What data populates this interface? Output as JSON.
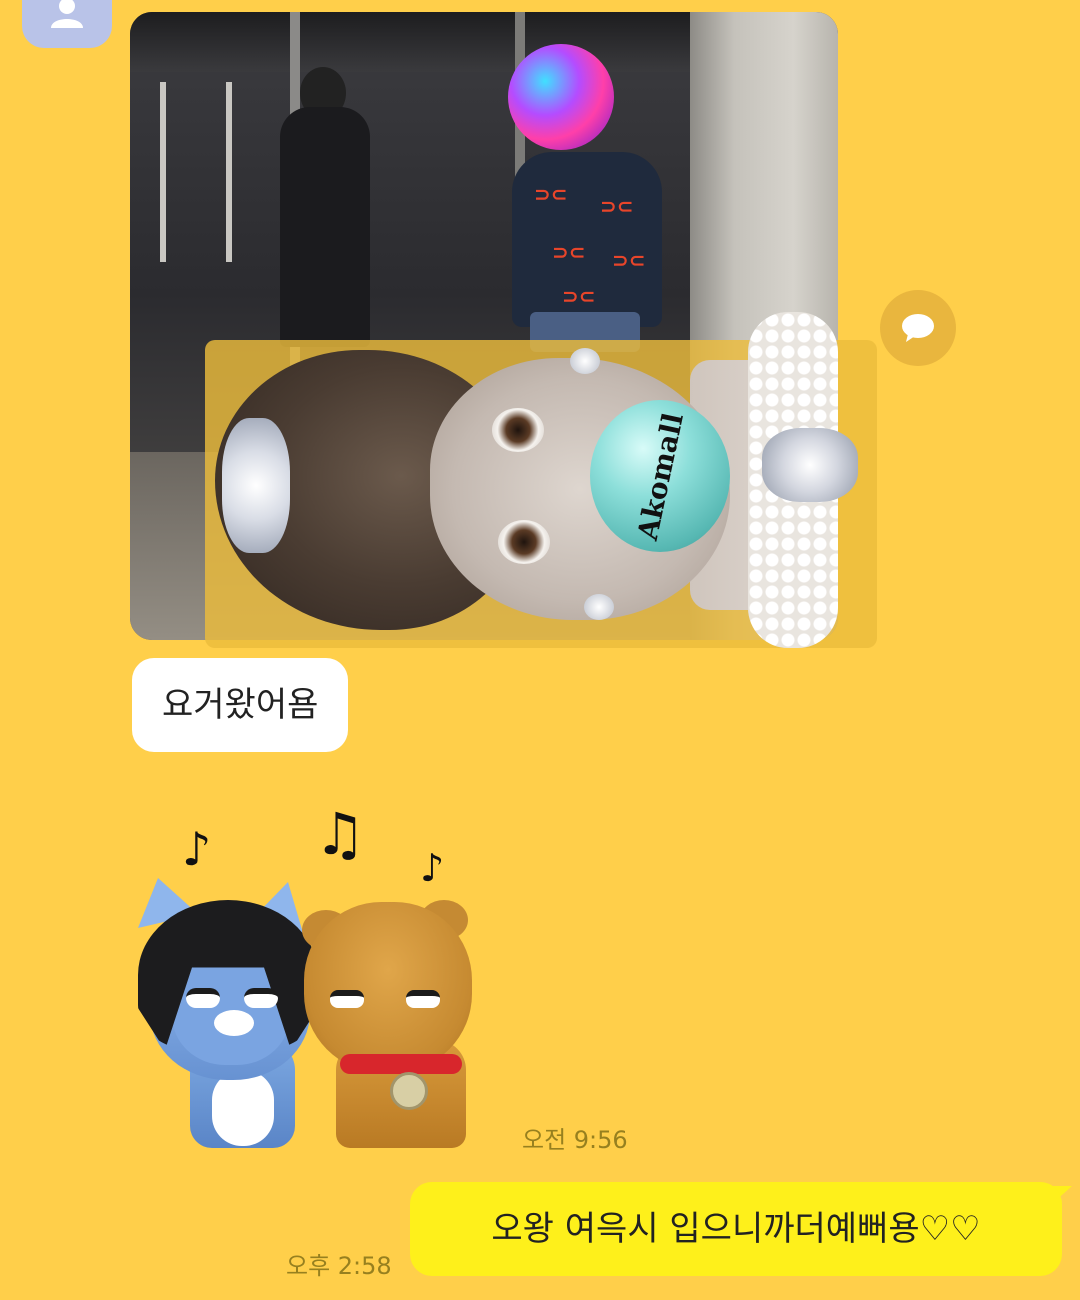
{
  "chat": {
    "photo_sticker_text": "Akomall",
    "received_message": "요거왔어욤",
    "received_time": "오전 9:56",
    "sent_message": "오왕 여윽시 입으니까더예뻐용♡♡",
    "sent_time": "오후 2:58"
  },
  "icons": {
    "avatar": "default-profile-icon",
    "comment": "speech-bubble-icon",
    "emoticon": "kakao-friends-neo-ryan-music-icon"
  },
  "colors": {
    "background": "#ffcf4a",
    "sent_bubble": "#fef01b",
    "received_bubble": "#ffffff",
    "time_text": "#97801f"
  }
}
